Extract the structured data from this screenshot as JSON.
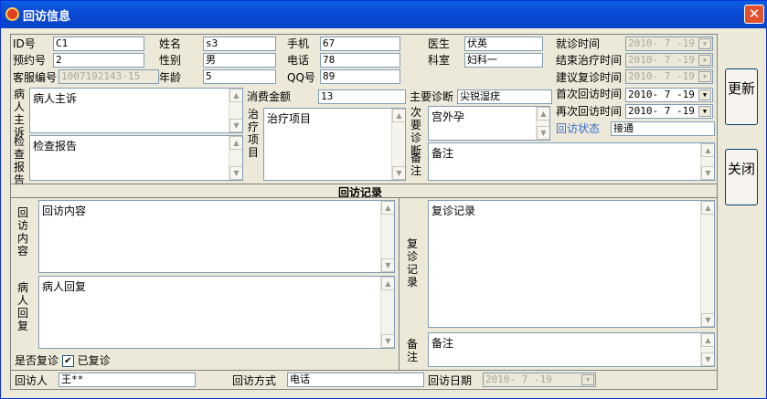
{
  "window": {
    "title": "回访信息"
  },
  "fields": {
    "id": {
      "label": "ID号",
      "value": "C1"
    },
    "appointment_no": {
      "label": "预约号",
      "value": "2"
    },
    "customer_no": {
      "label": "客服编号",
      "value": "1007192143-15"
    },
    "name": {
      "label": "姓名",
      "value": "s3"
    },
    "gender": {
      "label": "性别",
      "value": "男"
    },
    "age": {
      "label": "年龄",
      "value": "5"
    },
    "mobile": {
      "label": "手机",
      "value": "67"
    },
    "phone": {
      "label": "电话",
      "value": "78"
    },
    "qq": {
      "label": "QQ号",
      "value": "89"
    },
    "doctor": {
      "label": "医生",
      "value": "伏英"
    },
    "department": {
      "label": "科室",
      "value": "妇科一"
    },
    "visit_time": {
      "label": "就诊时间",
      "value": "2010- 7 -19"
    },
    "end_treatment_time": {
      "label": "结束治疗时间",
      "value": "2010- 7 -19"
    },
    "suggested_revisit_time": {
      "label": "建议复诊时间",
      "value": "2010- 7 -19"
    },
    "first_followup_time": {
      "label": "首次回访时间",
      "value": "2010- 7 -19"
    },
    "next_followup_time": {
      "label": "再次回访时间",
      "value": "2010- 7 -19"
    },
    "followup_status": {
      "label": "回访状态",
      "value": "接通"
    },
    "consumption": {
      "label": "消费金额",
      "value": "13"
    },
    "main_diagnosis": {
      "label": "主要诊断",
      "value": "尖锐湿疣"
    },
    "secondary_diagnosis": {
      "label": "次要诊断",
      "value": "宫外孕"
    },
    "note_top": {
      "label": "备注",
      "value": "备注"
    },
    "complaint": {
      "label": "病人主诉",
      "value": "病人主诉"
    },
    "exam_report": {
      "label": "检查报告",
      "value": "检查报告"
    },
    "treatment": {
      "label": "治疗项目",
      "value": "治疗项目"
    }
  },
  "followup": {
    "section_title": "回访记录",
    "content": {
      "label": "回访内容",
      "value": "回访内容"
    },
    "reply": {
      "label": "病人回复",
      "value": "病人回复"
    },
    "revisit_record": {
      "label": "复诊记录",
      "value": "复诊记录"
    },
    "note": {
      "label": "备注",
      "value": "备注"
    },
    "revisited_label": "是否复诊",
    "revisited_check_label": "已复诊",
    "visitor": {
      "label": "回访人",
      "value": "王**"
    },
    "method": {
      "label": "回访方式",
      "value": "电话"
    },
    "date": {
      "label": "回访日期",
      "value": "2010- 7 -19"
    }
  },
  "buttons": {
    "update": "更新",
    "close": "关闭"
  },
  "colors": {
    "title_bar": "#0b4ad6",
    "status_label": "#3a6fd0"
  }
}
